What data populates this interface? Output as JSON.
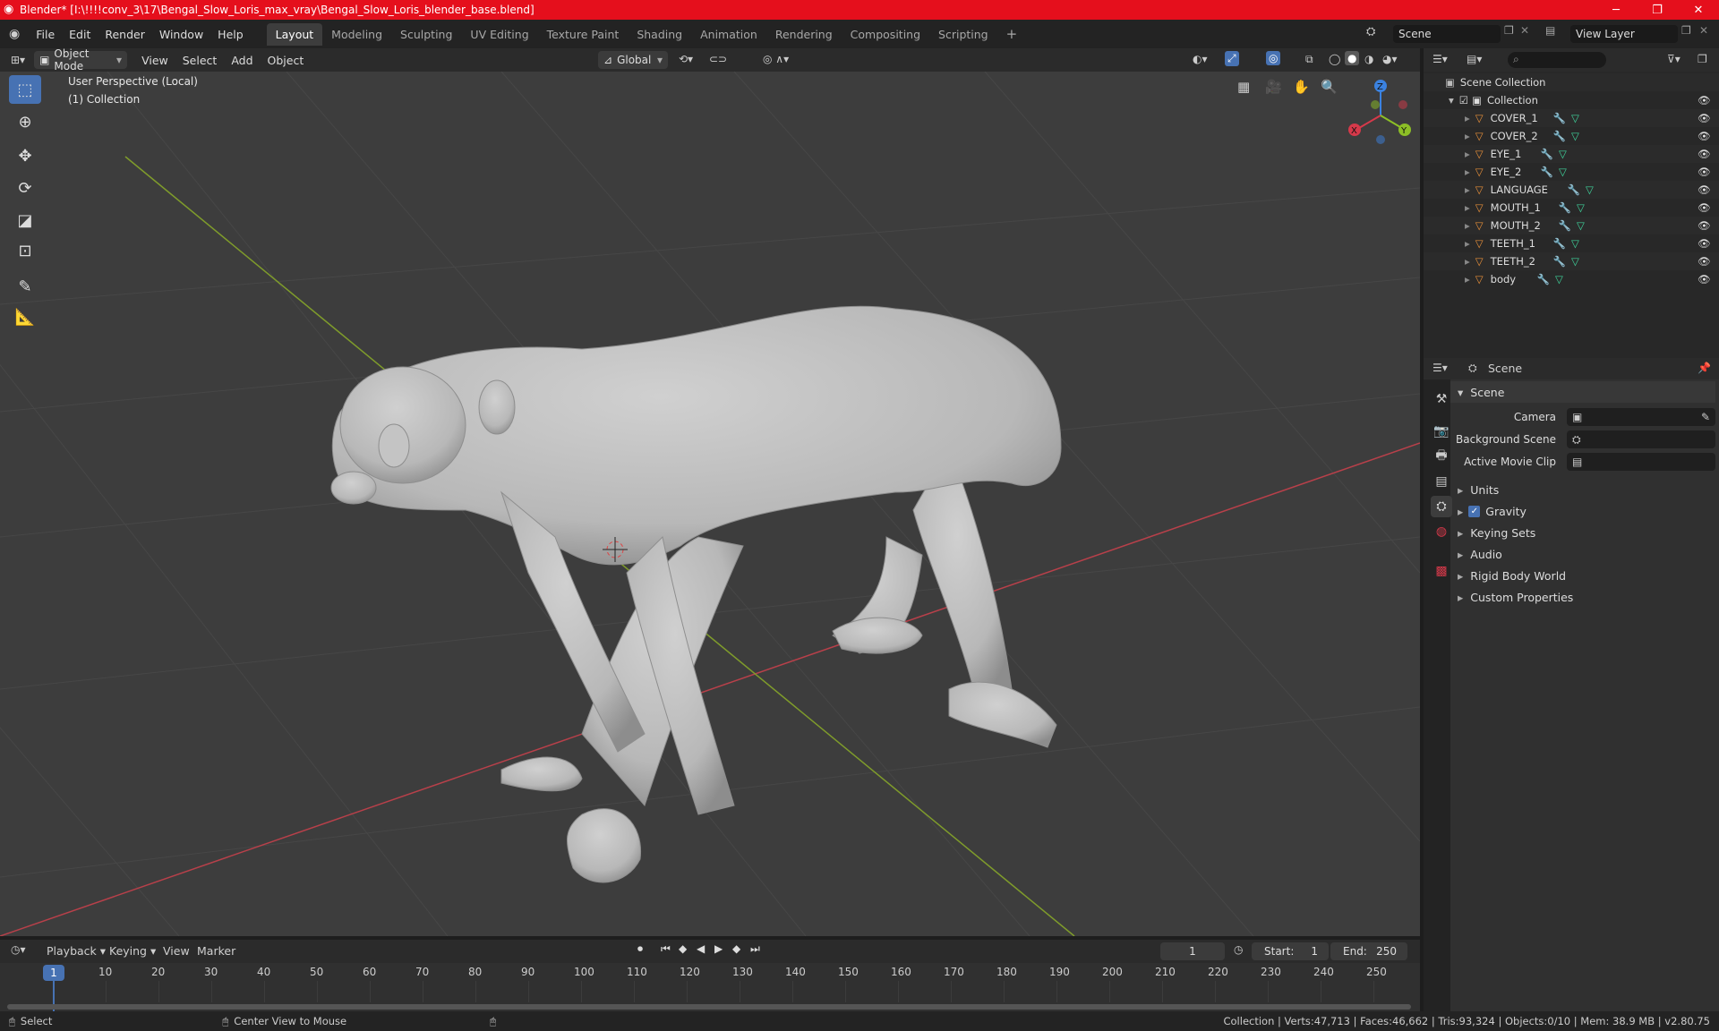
{
  "window": {
    "title": "Blender* [I:\\!!!!conv_3\\17\\Bengal_Slow_Loris_max_vray\\Bengal_Slow_Loris_blender_base.blend]"
  },
  "menu": [
    "File",
    "Edit",
    "Render",
    "Window",
    "Help"
  ],
  "workspaces": [
    "Layout",
    "Modeling",
    "Sculpting",
    "UV Editing",
    "Texture Paint",
    "Shading",
    "Animation",
    "Rendering",
    "Compositing",
    "Scripting"
  ],
  "scene_field": "Scene",
  "viewlayer_field": "View Layer",
  "viewport_header": {
    "mode": "Object Mode",
    "menus": [
      "View",
      "Select",
      "Add",
      "Object"
    ],
    "transform": "Global"
  },
  "viewport": {
    "perspective": "User Perspective (Local)",
    "collection": "(1) Collection",
    "axes": {
      "x": "X",
      "y": "Y",
      "z": "Z"
    }
  },
  "outliner": {
    "root": "Scene Collection",
    "collection": "Collection",
    "objects": [
      "COVER_1",
      "COVER_2",
      "EYE_1",
      "EYE_2",
      "LANGUAGE",
      "MOUTH_1",
      "MOUTH_2",
      "TEETH_1",
      "TEETH_2",
      "body"
    ]
  },
  "properties": {
    "header": "Scene",
    "panel": "Scene",
    "fields": [
      {
        "label": "Camera"
      },
      {
        "label": "Background Scene"
      },
      {
        "label": "Active Movie Clip"
      }
    ],
    "subpanels": [
      "Units",
      "Gravity",
      "Keying Sets",
      "Audio",
      "Rigid Body World",
      "Custom Properties"
    ],
    "gravity_checked": true
  },
  "timeline": {
    "menus": [
      "Playback",
      "Keying",
      "View",
      "Marker"
    ],
    "current_frame": "1",
    "start_label": "Start:",
    "start": "1",
    "end_label": "End:",
    "end": "250",
    "ticks": [
      "10",
      "20",
      "30",
      "40",
      "50",
      "60",
      "70",
      "80",
      "90",
      "100",
      "110",
      "120",
      "130",
      "140",
      "150",
      "160",
      "170",
      "180",
      "190",
      "200",
      "210",
      "220",
      "230",
      "240",
      "250"
    ]
  },
  "status": {
    "left": "Select",
    "middle": "Center View to Mouse",
    "right": "Collection | Verts:47,713 | Faces:46,662 | Tris:93,324 | Objects:0/10 | Mem: 38.9 MB | v2.80.75"
  },
  "colors": {
    "titlebar": "#e50f1c",
    "accent": "#4772b3",
    "x_axis": "#d6394a",
    "y_axis": "#8cbf26",
    "z_axis": "#3b82e0",
    "mesh_icon": "#e8903a",
    "modifier_icon": "#6c9ded",
    "data_icon": "#3fd49c"
  }
}
